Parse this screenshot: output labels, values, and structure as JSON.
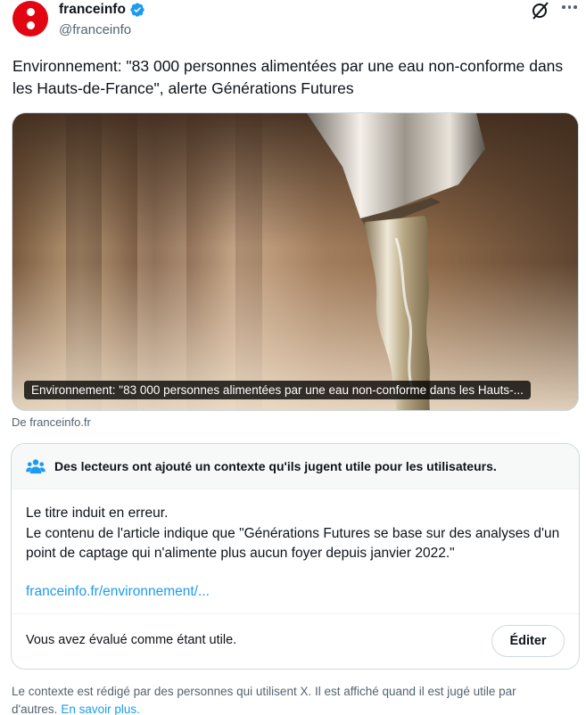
{
  "author": {
    "name": "franceinfo",
    "handle": "@franceinfo",
    "brand_color": "#e20613",
    "verified": true
  },
  "icons": {
    "verified": "verified-badge-icon",
    "grok": "grok-icon",
    "more": "more-options-icon",
    "note": "people-icon"
  },
  "tweet": {
    "text": "Environnement: \"83 000 personnes alimentées par une eau non-conforme dans les Hauts-de-France\", alerte Générations Futures"
  },
  "card": {
    "caption": "Environnement: \"83 000 personnes alimentées par une eau non-conforme dans les Hauts-...",
    "source": "De franceinfo.fr"
  },
  "community_note": {
    "title": "Des lecteurs ont ajouté un contexte qu'ils jugent utile pour les utilisateurs.",
    "line1": "Le titre induit en erreur.",
    "line2": "Le contenu de l'article indique que \"Générations Futures se base sur des analyses d'un point de captage qui n'alimente plus aucun foyer depuis janvier 2022.\"",
    "link": "franceinfo.fr/environnement/...",
    "rated_text": "Vous avez évalué comme étant utile.",
    "edit_label": "Éditer"
  },
  "footer": {
    "text": "Le contexte est rédigé par des personnes qui utilisent X. Il est affiché quand il est jugé utile par d'autres.",
    "link": "En savoir plus."
  },
  "colors": {
    "link": "#1d9bf0",
    "muted": "#536471",
    "text": "#0f1419"
  }
}
